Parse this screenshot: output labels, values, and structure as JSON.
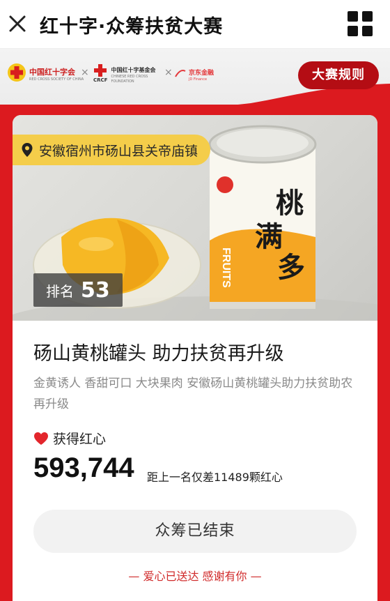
{
  "header": {
    "title": "红十字·众筹扶贫大赛",
    "close_icon": "close-icon",
    "menu_icon": "grid-menu-icon"
  },
  "sponsors": {
    "logo1": {
      "name": "中国红十字会",
      "sub": "RED CROSS SOCIETY OF CHINA"
    },
    "logo2": {
      "name": "中国红十字基金会",
      "abbr": "CRCF",
      "sub": "CHINESE RED CROSS FOUNDATION"
    },
    "logo3": {
      "name": "京东金融",
      "sub": "JD Finance"
    },
    "separator": "×",
    "rules_button": "大赛规则"
  },
  "project": {
    "location": "安徽宿州市砀山县关帝庙镇",
    "rank_label": "排名",
    "rank_value": "53",
    "title": "砀山黄桃罐头 助力扶贫再升级",
    "description": "金黄诱人 香甜可口 大块果肉 安徽砀山黄桃罐头助力扶贫助农再升级",
    "hearts_label": "获得红心",
    "hearts_count": "593,744",
    "gap_text": "距上一名仅差11489颗红心",
    "status_button": "众筹已结束",
    "footer_text": "— 爱心已送达 感谢有你 —"
  },
  "photo": {
    "can_brand": "桃满多",
    "can_label": "FRUITS"
  },
  "colors": {
    "brand_red": "#dc1a1f",
    "dark_red": "#b40d14",
    "location_yellow": "#f4cd4a"
  }
}
